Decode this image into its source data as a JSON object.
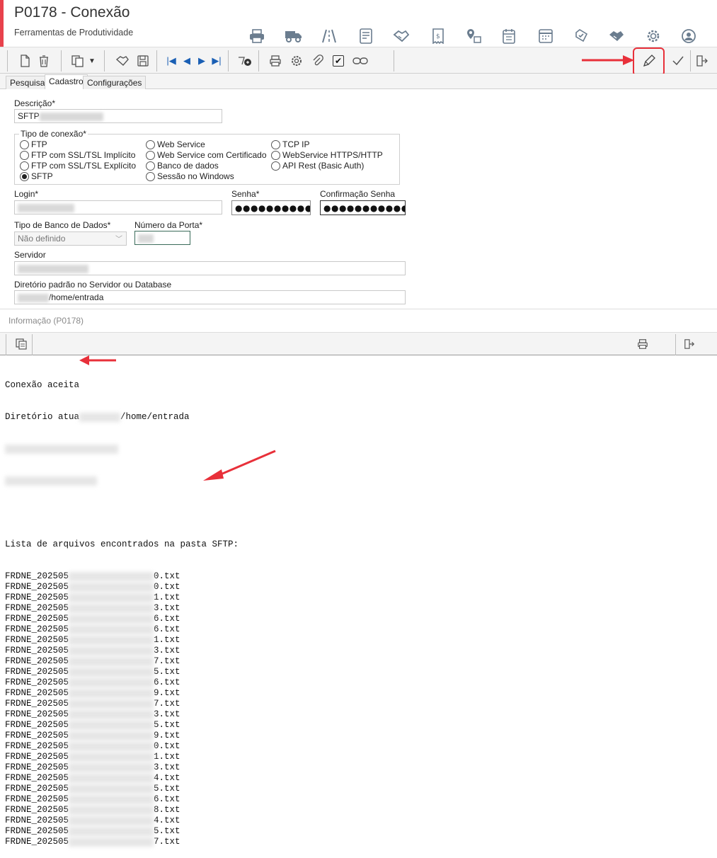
{
  "header": {
    "title": "P0178 - Conexão",
    "subtitle": "Ferramentas de Produtividade",
    "accent_color": "#e8424c"
  },
  "top_icons": [
    "printer-icon",
    "truck-icon",
    "road-icon",
    "finance-doc-icon",
    "handshake-icon",
    "invoice-icon",
    "location-box-icon",
    "calendar-icon",
    "grid-calendar-icon",
    "checklist-icon",
    "deal-icon",
    "gear-icon",
    "user-icon"
  ],
  "form": {
    "tabs": [
      "Pesquisa",
      "Cadastro",
      "Configurações"
    ],
    "active_tab": "Cadastro",
    "descricao_label": "Descrição*",
    "descricao_value": "SFTP",
    "tipo_conexao_label": "Tipo de conexão*",
    "connection_options": [
      "FTP",
      "FTP com SSL/TSL Implícito",
      "FTP com SSL/TSL Explícito",
      "SFTP",
      "Web Service",
      "Web Service com Certificado",
      "Banco de dados",
      "Sessão no Windows",
      "TCP IP",
      "WebService HTTPS/HTTP",
      "API Rest (Basic Auth)"
    ],
    "selected_connection": "SFTP",
    "login_label": "Login*",
    "senha_label": "Senha*",
    "senha_value": "●●●●●●●●●●●●●",
    "confirmacao_label": "Confirmação Senha",
    "confirmacao_value": "●●●●●●●●●●●●●",
    "tipo_banco_label": "Tipo de Banco de Dados*",
    "tipo_banco_value": "Não definido",
    "porta_label": "Número da Porta*",
    "servidor_label": "Servidor",
    "diretorio_label": "Diretório padrão no Servidor ou Database",
    "diretorio_value": "/home/entrada"
  },
  "info": {
    "title": "Informação (P0178)",
    "log_line1": "Conexão aceita",
    "log_line2_prefix": "Diretório atua",
    "log_line2_suffix": "/home/entrada",
    "list_header": "Lista de arquivos encontrados na pasta SFTP:",
    "file_prefix": "FRDNE_202505",
    "file_suffixes": [
      "0.txt",
      "0.txt",
      "1.txt",
      "3.txt",
      "6.txt",
      "6.txt",
      "1.txt",
      "3.txt",
      "7.txt",
      "5.txt",
      "6.txt",
      "9.txt",
      "7.txt",
      "3.txt",
      "5.txt",
      "9.txt",
      "0.txt",
      "1.txt",
      "3.txt",
      "4.txt",
      "5.txt",
      "6.txt",
      "8.txt",
      "4.txt",
      "5.txt",
      "7.txt"
    ]
  }
}
